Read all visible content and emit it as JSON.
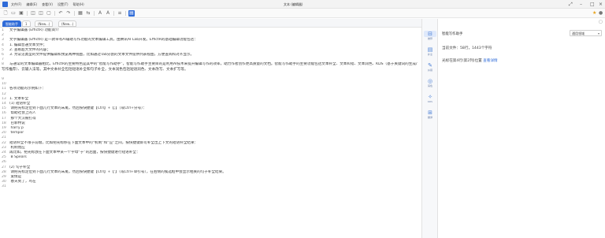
{
  "app": {
    "title": "文本 (编辑器)",
    "menus": [
      "文件(F)",
      "编辑(E)",
      "查看(V)",
      "设置(T)",
      "帮助(H)"
    ]
  },
  "toolbar": {
    "icons": [
      "new-file-icon",
      "open-file-icon",
      "save-icon",
      "cut-icon",
      "copy-icon",
      "paste-icon",
      "undo-icon",
      "redo-icon",
      "find-icon",
      "replace-icon",
      "font-increase-icon",
      "font-decrease-icon",
      "format-icon",
      "ai-icon"
    ],
    "active": "ai-icon"
  },
  "tabs": [
    {
      "label": "智能助手",
      "active": true
    },
    {
      "label": "1",
      "active": false
    },
    {
      "label": "(New...)",
      "active": false
    },
    {
      "label": "(New...)",
      "active": false
    }
  ],
  "editor": {
    "lines": [
      "文字编辑器 (EffictR) 功能简介",
      "",
      "文字编辑器 (EffictR) 是一款带有AI辅助写作功能的文本编辑工具，由腾讯AI Lab开发。EffictR的基础编辑功能包括：",
      "1. 编辑普通文本文件；",
      "2. 查看超大文件的内容；",
      "3. 为常见类型的文件提供编辑和预览两种视图，比如通过Tab分割的文本文件提供列表视图，方便查阅和对齐显示。",
      "",
      "与通常的文本编辑器相比，EffictR的主要特色是其中的“智能写作助手”，智能写作助手主要目的是利用AI技术来提升编辑写作的效率，助力作者创作更高质量的文档。智能写作助手的主要功能包括文本补全、文本纠错、文本润色、KDS（基于关键词的生成/写作推荐）、云输入法等。其中文本补全包括短语补全和句子补全，文本润色包括短语润色、文本改写、文本扩写等。",
      "",
      "",
      "各项功能的示例如下：",
      "",
      "1. 文本补全",
      "(1) 短语补全",
      "    请把光标定位到下面几行文本的末尾，然后按快捷键【Ctrl】+【;】（或Ctrl+分号）：",
      "        帮助社会上的人",
      "        那个大汉被打得",
      "        巴菲特说",
      "        harry p",
      "        tempor",
      "",
      "短语补全不限于前缀，比如把光标移在下面文本中的“机制”和“应”之间，按快捷键即可补全出上下文的短语补全结果：",
      "    机制而应",
      "再比如，把光标放在下面文本中某一个字母“于”的后面，按快捷键进行短语补全：",
      "    B Spears",
      "",
      "(2) 句子补全",
      "    请把光标定位到下面几行文本的末尾，然后按快捷键【Ctrl】+【'】（或Ctrl+单引号），在右侧的候选框中会显示相关的句子补全结果。",
      "        爱情是",
      "        春天到了，鸟在",
      "        "
    ]
  },
  "sidebar": {
    "items": [
      {
        "label": "推荐",
        "icon": "recommend-icon"
      },
      {
        "label": "补全",
        "icon": "completion-icon"
      },
      {
        "label": "纠错",
        "icon": "correction-icon"
      },
      {
        "label": "润色",
        "icon": "polish-icon"
      },
      {
        "label": "KDS",
        "icon": "kds-icon"
      },
      {
        "label": "翻译",
        "icon": "translate-icon"
      }
    ]
  },
  "rightPanel": {
    "title": "智能写作助手",
    "dropdown": "通用领域",
    "stats": "当前文件：58行，1443个字符",
    "pos_prefix": "光标在第4行(第2列)位置",
    "pos_link": "查看详情"
  }
}
